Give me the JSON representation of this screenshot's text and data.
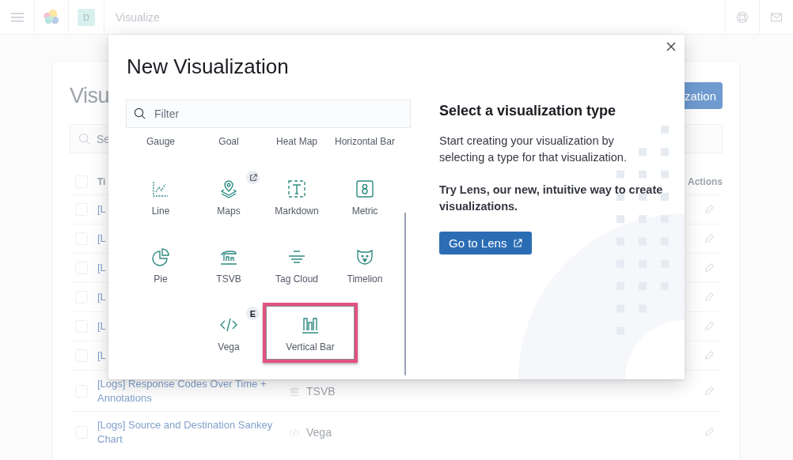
{
  "header": {
    "space_initial": "D",
    "app_title": "Visualize"
  },
  "background": {
    "title": "Visu",
    "action_button": "zation",
    "search_placeholder": "Se",
    "columns": {
      "title": "Ti",
      "actions": "Actions",
      "checked": false
    },
    "rows": [
      {
        "title": "[L",
        "checked": false
      },
      {
        "title": "[L",
        "checked": false
      },
      {
        "title": "[L",
        "checked": false
      },
      {
        "title": "[L",
        "checked": false
      },
      {
        "title": "[L",
        "checked": false
      },
      {
        "title": "[L",
        "checked": false
      },
      {
        "title": "[Logs] Response Codes Over Time + Annotations",
        "type": "TSVB",
        "kind": "tsvb",
        "checked": false
      },
      {
        "title": "[Logs] Source and Destination Sankey Chart",
        "type": "Vega",
        "kind": "vega",
        "checked": false
      }
    ]
  },
  "modal": {
    "title": "New Visualization",
    "filter": {
      "placeholder": "Filter"
    },
    "type_rows": [
      {
        "items": [
          {
            "label": "Gauge",
            "selected": false
          },
          {
            "label": "Goal",
            "selected": false
          },
          {
            "label": "Heat Map",
            "selected": false
          },
          {
            "label": "Horizontal Bar",
            "selected": false
          }
        ]
      },
      {
        "items": [
          {
            "label": "Line",
            "kind": "line",
            "selected": false
          },
          {
            "label": "Maps",
            "kind": "maps",
            "badge": {
              "kind": "external"
            },
            "selected": false
          },
          {
            "label": "Markdown",
            "kind": "markdown",
            "selected": false
          },
          {
            "label": "Metric",
            "kind": "metric",
            "selected": false
          }
        ]
      },
      {
        "items": [
          {
            "label": "Pie",
            "kind": "pie",
            "selected": false
          },
          {
            "label": "TSVB",
            "kind": "tsvb",
            "selected": false
          },
          {
            "label": "Tag Cloud",
            "kind": "tagcloud",
            "selected": false
          },
          {
            "label": "Timelion",
            "kind": "timelion",
            "selected": false
          }
        ]
      },
      {
        "items": [
          {
            "label": "Vega",
            "kind": "vega",
            "badge": {
              "kind": "letter",
              "text": "E"
            },
            "selected": false
          },
          {
            "label": "Vertical Bar",
            "kind": "vbar",
            "selected": true
          }
        ]
      }
    ],
    "info": {
      "heading": "Select a visualization type",
      "text": "Start creating your visualization by selecting a type for that visualization.",
      "lens_text": "Try Lens, our new, intuitive way to create visualizations.",
      "lens_button": "Go to Lens"
    }
  }
}
